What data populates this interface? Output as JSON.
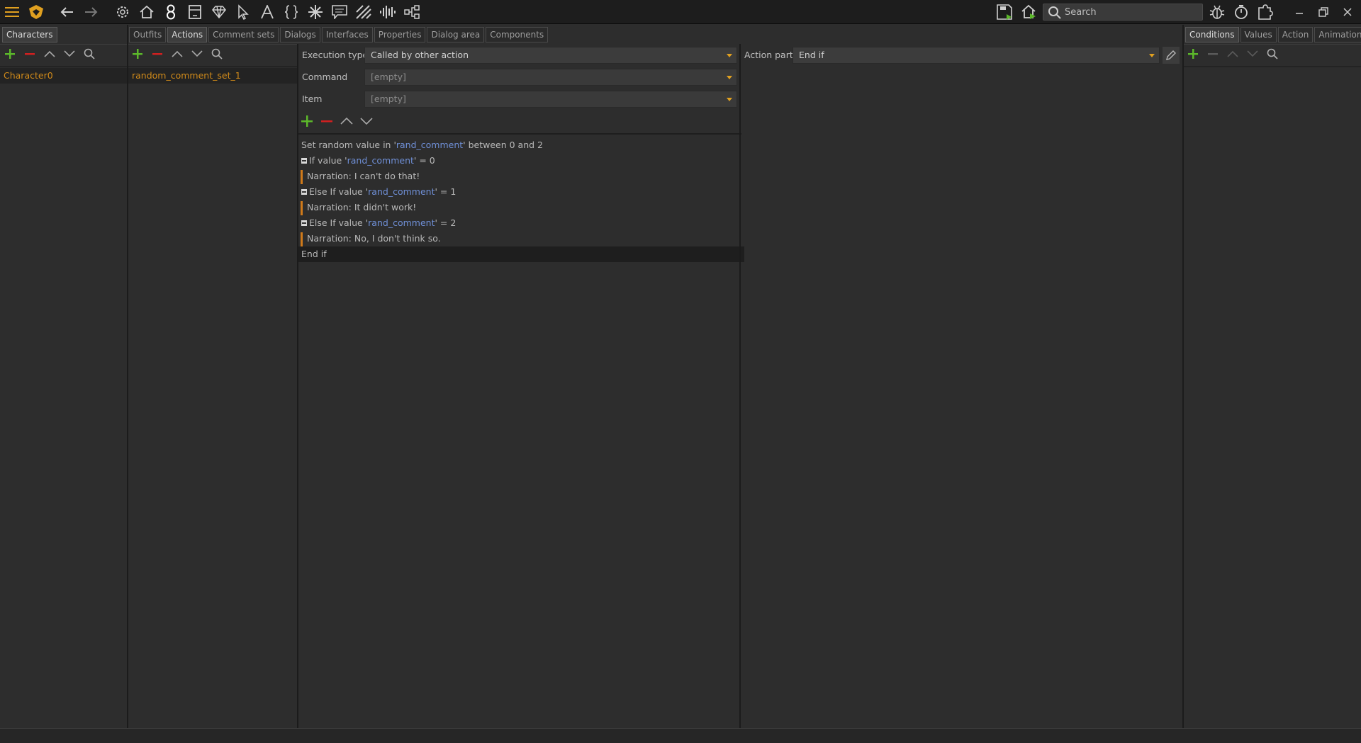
{
  "search": {
    "placeholder": "Search"
  },
  "left_panel": {
    "tab": "Characters",
    "items": [
      "Character0"
    ]
  },
  "middle_tabs": [
    "Outfits",
    "Actions",
    "Comment sets",
    "Dialogs",
    "Interfaces",
    "Properties",
    "Dialog area",
    "Components"
  ],
  "middle_tabs_active": "Actions",
  "actions_list": {
    "items": [
      "random_comment_set_1"
    ]
  },
  "action_editor": {
    "execution_type_label": "Execution type",
    "execution_type_value": "Called by other action",
    "command_label": "Command",
    "command_value": "[empty]",
    "item_label": "Item",
    "item_value": "[empty]",
    "action_part_label": "Action part",
    "action_part_value": "End if"
  },
  "script": {
    "l0_a": "Set random value in '",
    "l0_v": "rand_comment",
    "l0_b": "' between 0 and 2",
    "l1_a": "If value '",
    "l1_v": "rand_comment",
    "l1_b": "' = 0",
    "l2": "Narration: I can't do that!",
    "l3_a": "Else If value '",
    "l3_v": "rand_comment",
    "l3_b": "' = 1",
    "l4": "Narration: It didn't work!",
    "l5_a": "Else If value '",
    "l5_v": "rand_comment",
    "l5_b": "' = 2",
    "l6": "Narration: No, I don't think so.",
    "l7": "End if"
  },
  "right_tabs": [
    "Conditions",
    "Values",
    "Action",
    "Animation fram"
  ],
  "right_tabs_active": "Conditions",
  "colors": {
    "accent": "#e0a020",
    "add": "#5cb82a",
    "remove": "#d02020",
    "value": "#6f8fd6",
    "list_item": "#d08a1a"
  }
}
